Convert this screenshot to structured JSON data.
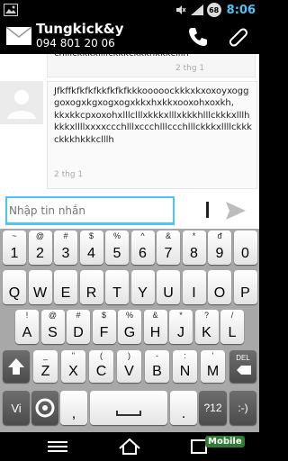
{
  "status": {
    "battery_percent": "68",
    "time": "8:06"
  },
  "contact": {
    "name": "Tungkick&y",
    "number": "094 801 20 06"
  },
  "messages": {
    "top_text": "chlllckkkxllllckkkckkkhkkkclllh",
    "top_time": "2 thg 1",
    "main_text": "Jfkffkfkfkfkkfkfkfkkkooooockkkxkxoxoyxogggoxogxkgxogxogxkkxhxkkxooxohxoxkh, kkxkkcpxoxohxlllclllxkkkxlllxkkkhlllckkkxlllhkkkxllllxxxxccchlllxccchlllccchlllckkkxllllckkkckkkhkkkclllh",
    "main_time": "2 thg 1"
  },
  "compose": {
    "placeholder": "Nhập tin nhắn"
  },
  "keyboard": {
    "row1": [
      {
        "sub": "~",
        "main": "1"
      },
      {
        "sub": "@",
        "main": "2"
      },
      {
        "sub": "#",
        "main": "3"
      },
      {
        "sub": "$",
        "main": "4"
      },
      {
        "sub": "%",
        "main": "5"
      },
      {
        "sub": "^",
        "main": "6"
      },
      {
        "sub": "&",
        "main": "7"
      },
      {
        "sub": "*",
        "main": "8"
      },
      {
        "sub": "đ",
        "main": "9"
      },
      {
        "sub": "",
        "main": "0"
      }
    ],
    "row2": [
      {
        "sub": "",
        "main": "Q"
      },
      {
        "sub": "",
        "main": "W"
      },
      {
        "sub": "",
        "main": "E"
      },
      {
        "sub": "",
        "main": "R"
      },
      {
        "sub": "",
        "main": "T"
      },
      {
        "sub": "",
        "main": "Y"
      },
      {
        "sub": "",
        "main": "U"
      },
      {
        "sub": "",
        "main": "I"
      },
      {
        "sub": "",
        "main": "O"
      },
      {
        "sub": "",
        "main": "P"
      }
    ],
    "row3": [
      {
        "sub": "!",
        "main": "A"
      },
      {
        "sub": "@",
        "main": "S"
      },
      {
        "sub": "#",
        "main": "D"
      },
      {
        "sub": "$",
        "main": "F"
      },
      {
        "sub": "%",
        "main": "G"
      },
      {
        "sub": "&",
        "main": "H"
      },
      {
        "sub": "*",
        "main": "J"
      },
      {
        "sub": "?",
        "main": "K"
      },
      {
        "sub": "/",
        "main": "L"
      }
    ],
    "row4": [
      {
        "sub": "_",
        "main": "Z"
      },
      {
        "sub": "\"",
        "main": "X"
      },
      {
        "sub": "(",
        "main": "C"
      },
      {
        "sub": ")",
        "main": "V"
      },
      {
        "sub": "-",
        "main": "B"
      },
      {
        "sub": ":",
        "main": "N"
      },
      {
        "sub": "'",
        "main": "M"
      }
    ],
    "del_label": "DEL",
    "lang_label": "Vi",
    "comma_label": ",",
    "period_label": ".",
    "sym_label": "?12",
    "smile_label": ":-)"
  },
  "watermark": "Mobile"
}
